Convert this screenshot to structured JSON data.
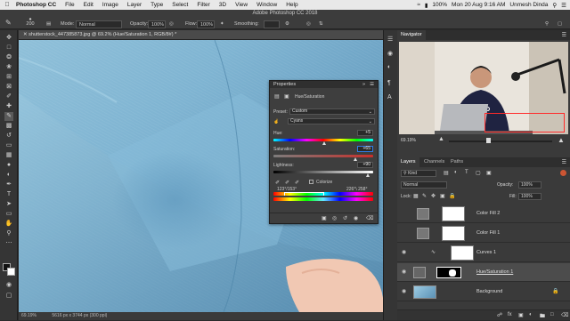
{
  "menubar": {
    "app_name": "Photoshop CC",
    "items": [
      "File",
      "Edit",
      "Image",
      "Layer",
      "Type",
      "Select",
      "Filter",
      "3D",
      "View",
      "Window",
      "Help"
    ],
    "battery": "100%",
    "clock": "Mon 20 Aug  9:16 AM",
    "user": "Unmesh Dinda"
  },
  "window_title": "Adobe Photoshop CC 2018",
  "options": {
    "brush_size": "200",
    "mode_label": "Mode:",
    "mode_value": "Normal",
    "opacity_label": "Opacity:",
    "opacity_value": "100%",
    "flow_label": "Flow:",
    "flow_value": "100%",
    "smoothing_label": "Smoothing:"
  },
  "document": {
    "tab_title": "shutterstock_447385873.jpg @ 69.2% (Hue/Saturation 1, RGB/8#) *",
    "zoom": "69.19%",
    "doc_size": "5616 px x 3744 px (300 ppi)"
  },
  "properties": {
    "panel_title": "Properties",
    "adjustment_name": "Hue/Saturation",
    "preset_label": "Preset:",
    "preset_value": "Custom",
    "channel_value": "Cyans",
    "hue_label": "Hue:",
    "hue_value": "+5",
    "saturation_label": "Saturation:",
    "saturation_value": "+65",
    "lightness_label": "Lightness:",
    "lightness_value": "+90",
    "colorize_label": "Colorize",
    "range_left": "123°/153°",
    "range_right": "226°\\ 258°",
    "hue_level": 5,
    "saturation_level": 65,
    "lightness_level": 90
  },
  "navigator": {
    "tab_label": "Navigator",
    "zoom": "69.19%"
  },
  "layers": {
    "tabs": [
      "Layers",
      "Channels",
      "Paths"
    ],
    "kind_label": "Kind",
    "blend_mode": "Normal",
    "opacity_label": "Opacity:",
    "opacity_value": "100%",
    "lock_label": "Lock:",
    "fill_label": "Fill:",
    "fill_value": "100%",
    "items": [
      {
        "name": "Color Fill 2",
        "visible": false
      },
      {
        "name": "Color Fill 1",
        "visible": false
      },
      {
        "name": "Curves 1",
        "visible": true
      },
      {
        "name": "Hue/Saturation 1",
        "visible": true,
        "selected": true
      },
      {
        "name": "Background",
        "visible": true
      }
    ]
  },
  "colors": {
    "accent": "#2f7be5",
    "shirt": "#7fb4d2",
    "panel": "#3a3a3a"
  }
}
